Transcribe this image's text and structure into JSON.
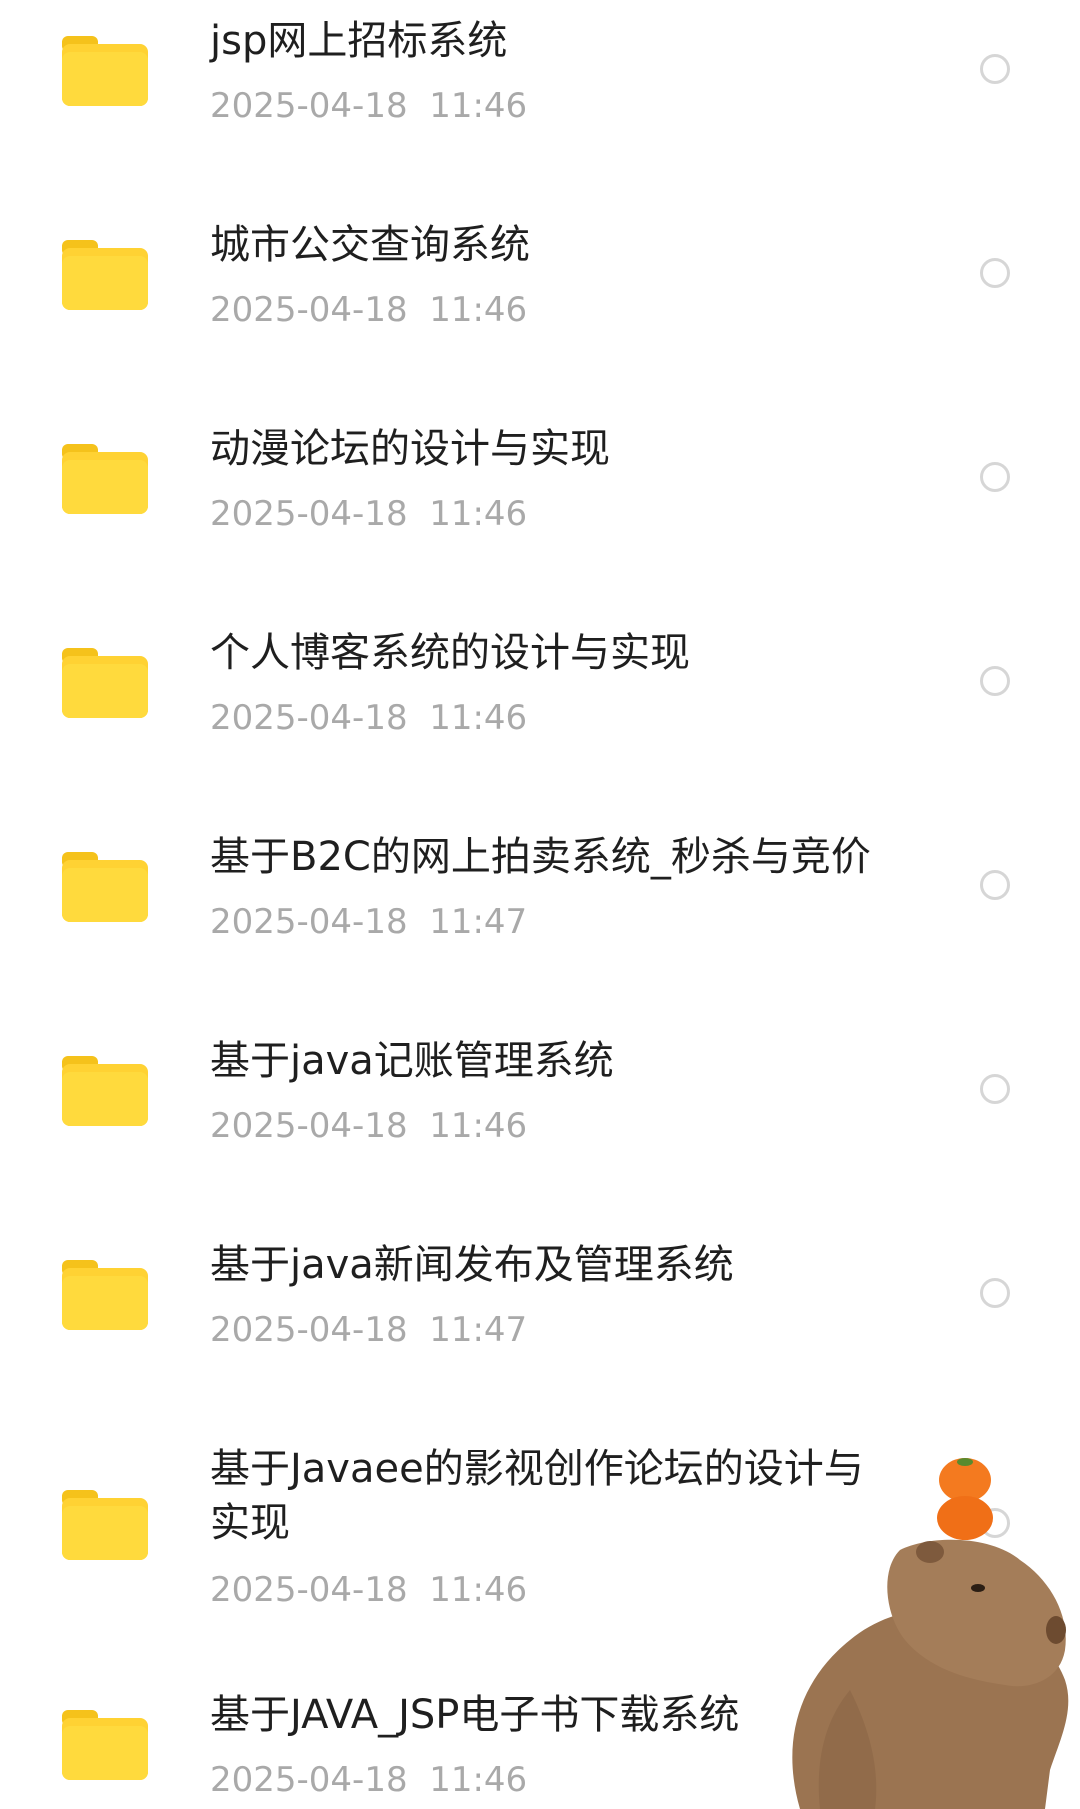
{
  "colors": {
    "folder": "#ffd233",
    "folder_tab": "#f5c21b",
    "name_text": "#1f1f1f",
    "date_text": "#a9a9a9",
    "radio_border": "#d6d6d6"
  },
  "files": [
    {
      "name": "jsp网上招标系统",
      "date": "2025-04-18  11:46",
      "icon": "folder-icon"
    },
    {
      "name": "城市公交查询系统",
      "date": "2025-04-18  11:46",
      "icon": "folder-icon"
    },
    {
      "name": "动漫论坛的设计与实现",
      "date": "2025-04-18  11:46",
      "icon": "folder-icon"
    },
    {
      "name": "个人博客系统的设计与实现",
      "date": "2025-04-18  11:46",
      "icon": "folder-icon"
    },
    {
      "name": "基于B2C的网上拍卖系统_秒杀与竞价",
      "date": "2025-04-18  11:47",
      "icon": "folder-icon"
    },
    {
      "name": "基于java记账管理系统",
      "date": "2025-04-18  11:46",
      "icon": "folder-icon"
    },
    {
      "name": "基于java新闻发布及管理系统",
      "date": "2025-04-18  11:47",
      "icon": "folder-icon"
    },
    {
      "name": "基于Javaee的影视创作论坛的设计与实现",
      "date": "2025-04-18  11:46",
      "icon": "folder-icon"
    },
    {
      "name": "基于JAVA_JSP电子书下载系统",
      "date": "2025-04-18  11:46",
      "icon": "folder-icon"
    }
  ],
  "overlay": {
    "icon": "capybara-sticker-icon"
  }
}
